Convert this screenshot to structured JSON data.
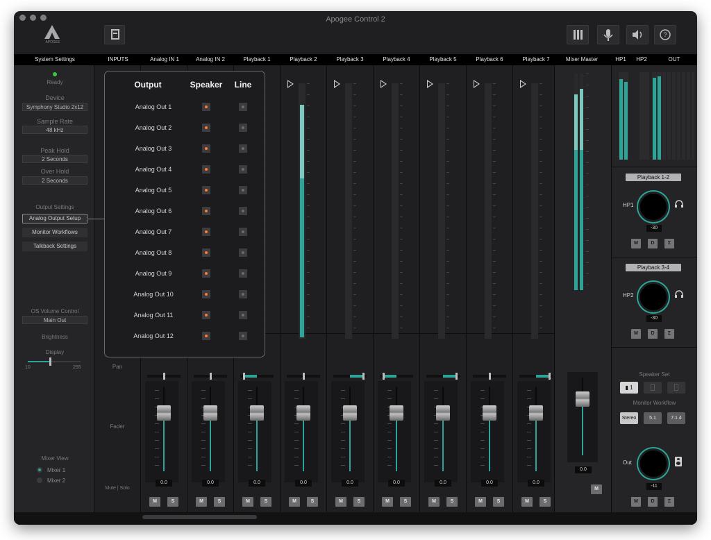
{
  "window": {
    "title": "Apogee Control 2",
    "brand": "APOGEE"
  },
  "header_buttons": {
    "meters_icon": "meters-icon",
    "mic_icon": "mic-icon",
    "speaker_icon": "speaker-icon",
    "help_icon": "help-icon"
  },
  "columns": {
    "system_settings": "System Settings",
    "inputs": "INPUTS",
    "channels": [
      "Analog IN 1",
      "Analog IN 2",
      "Playback 1",
      "Playback 2",
      "Playback 3",
      "Playback 4",
      "Playback 5",
      "Playback 6",
      "Playback 7"
    ],
    "mixer_master": "Mixer Master",
    "hp1": "HP1",
    "hp2": "HP2",
    "out": "OUT"
  },
  "sidebar": {
    "status": "Ready",
    "device_label": "Device",
    "device_value": "Symphony Studio 2x12",
    "sample_rate_label": "Sample Rate",
    "sample_rate_value": "48 kHz",
    "peak_hold_label": "Peak Hold",
    "peak_hold_value": "2 Seconds",
    "over_hold_label": "Over Hold",
    "over_hold_value": "2 Seconds",
    "output_settings_label": "Output Settings",
    "analog_output_setup": "Analog Output Setup",
    "monitor_workflows": "Monitor Workflows",
    "talkback_settings": "Talkback Settings",
    "os_volume_label": "OS Volume Control",
    "os_volume_value": "Main Out",
    "brightness_label": "Brightness",
    "display_label": "Display",
    "slider_min": "10",
    "slider_max": "255",
    "mixer_view_label": "Mixer View",
    "mixer_1": "Mixer 1",
    "mixer_2": "Mixer 2"
  },
  "input_labels": {
    "pan": "Pan",
    "fader": "Fader",
    "mute_solo": "Mute | Solo"
  },
  "channel_strip": {
    "fader_value": "0.0",
    "mute": "M",
    "solo": "S"
  },
  "mixer_master": {
    "fader_value": "0.0",
    "mute": "M"
  },
  "overlay": {
    "headers": {
      "output": "Output",
      "speaker": "Speaker",
      "line": "Line"
    },
    "rows": [
      "Analog Out 1",
      "Analog Out 2",
      "Analog Out 3",
      "Analog Out 4",
      "Analog Out 5",
      "Analog Out 6",
      "Analog Out 7",
      "Analog Out 8",
      "Analog Out 9",
      "Analog Out 10",
      "Analog Out 11",
      "Analog Out 12"
    ]
  },
  "right_panel": {
    "hp1": {
      "source": "Playback 1-2",
      "label": "HP1",
      "value": "-30"
    },
    "hp2": {
      "source": "Playback 3-4",
      "label": "HP2",
      "value": "-30"
    },
    "buttons": {
      "m": "M",
      "d": "D",
      "sum": "Σ"
    },
    "speaker_set_label": "Speaker Set",
    "speaker_set_active": "1",
    "monitor_workflow_label": "Monitor Workflow",
    "workflows": [
      "Stereo",
      "5.1",
      "7.1.4"
    ],
    "out": {
      "label": "Out",
      "value": "-11"
    }
  },
  "colors": {
    "accent": "#2ea397",
    "speaker_dot": "#ff7a2e",
    "background": "#1f1f21"
  }
}
